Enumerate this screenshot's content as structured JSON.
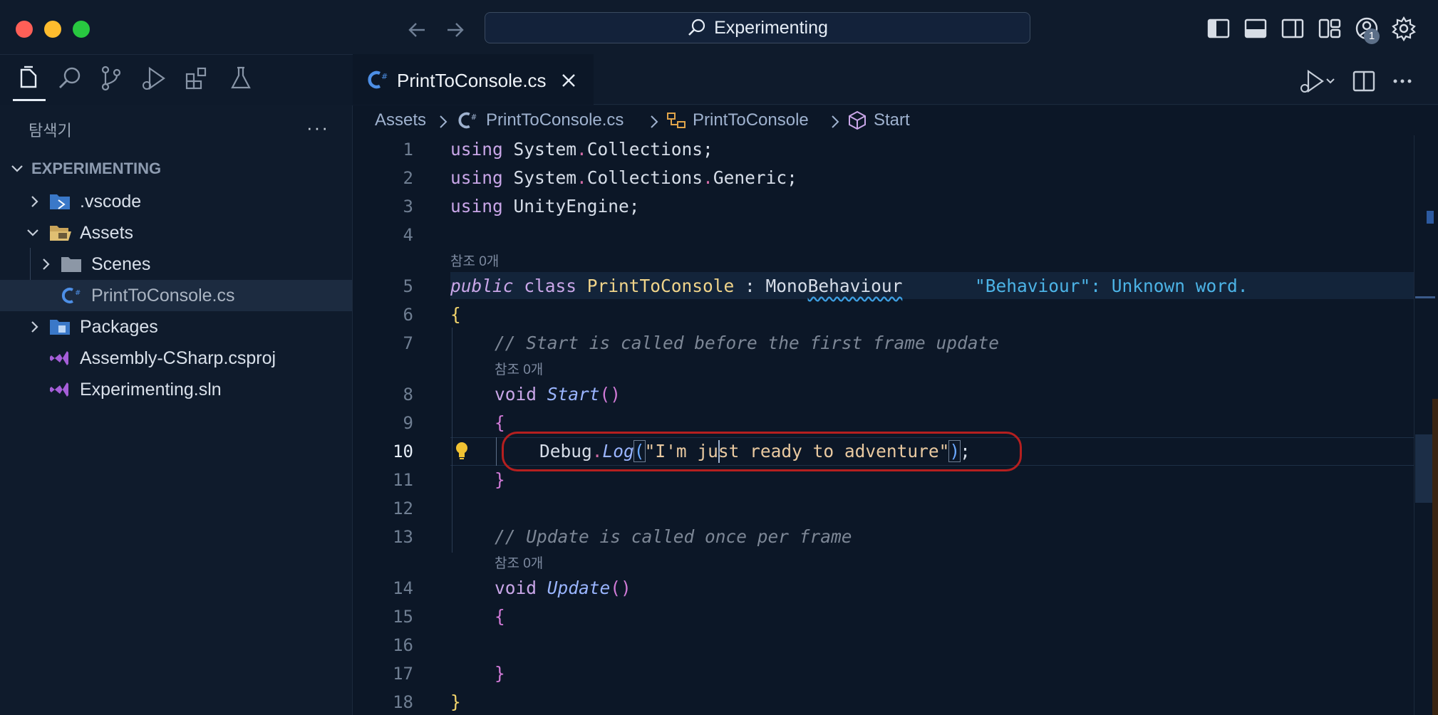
{
  "window": {
    "search_label": "Experimenting",
    "account_badge": "1"
  },
  "activity_bar": {
    "items": [
      "explorer-icon",
      "search-icon",
      "source-control-icon",
      "run-debug-icon",
      "extensions-icon",
      "testing-icon"
    ]
  },
  "sidebar": {
    "title": "탐색기",
    "more": "···",
    "root": "EXPERIMENTING",
    "items": [
      {
        "label": ".vscode",
        "type": "folder-vscode"
      },
      {
        "label": "Assets",
        "type": "folder-open"
      },
      {
        "label": "Scenes",
        "type": "folder"
      },
      {
        "label": "PrintToConsole.cs",
        "type": "csharp"
      },
      {
        "label": "Packages",
        "type": "folder-packages"
      },
      {
        "label": "Assembly-CSharp.csproj",
        "type": "vs"
      },
      {
        "label": "Experimenting.sln",
        "type": "vs"
      }
    ]
  },
  "editor": {
    "tab": {
      "label": "PrintToConsole.cs",
      "icon": "csharp-icon"
    },
    "breadcrumb": [
      "Assets",
      "PrintToConsole.cs",
      "PrintToConsole",
      "Start"
    ],
    "code_lens": "참조 0개",
    "lines": {
      "l1a": "using",
      "l1b": " System",
      "l1c": ".",
      "l1d": "Collections;",
      "l2a": "using",
      "l2b": " System",
      "l2c": ".",
      "l2d": "Collections",
      "l2e": ".",
      "l2f": "Generic;",
      "l3a": "using",
      "l3b": " UnityEngine;",
      "l5a": "public",
      "l5b": " class ",
      "l5c": "PrintToConsole",
      "l5d": " : Mono",
      "l5e": "Behaviour",
      "diagnostic": "\"Behaviour\": Unknown word.",
      "l6": "{",
      "l7": "// Start is called before the first frame update",
      "l8a": "void ",
      "l8b": "Start",
      "l8c": "()",
      "l9": "{",
      "l10a": "Debug",
      "l10b": ".",
      "l10c": "Log",
      "l10d": "(",
      "l10e": "\"I'm just ready to adventure\"",
      "l10f": ")",
      "l10g": ";",
      "l11": "}",
      "l13": "// Update is called once per frame",
      "l14a": "void ",
      "l14b": "Update",
      "l14c": "()",
      "l15": "{",
      "l17": "}",
      "l18": "}"
    },
    "line_numbers": [
      "1",
      "2",
      "3",
      "4",
      "5",
      "6",
      "7",
      "8",
      "9",
      "10",
      "11",
      "12",
      "13",
      "14",
      "15",
      "16",
      "17",
      "18"
    ],
    "current_line": "10"
  },
  "colors": {
    "annotation": "#b51f1f",
    "background": "#0c1727",
    "keyword": "#c9a6e8",
    "class": "#f0d48a",
    "string": "#e9c9a0"
  }
}
